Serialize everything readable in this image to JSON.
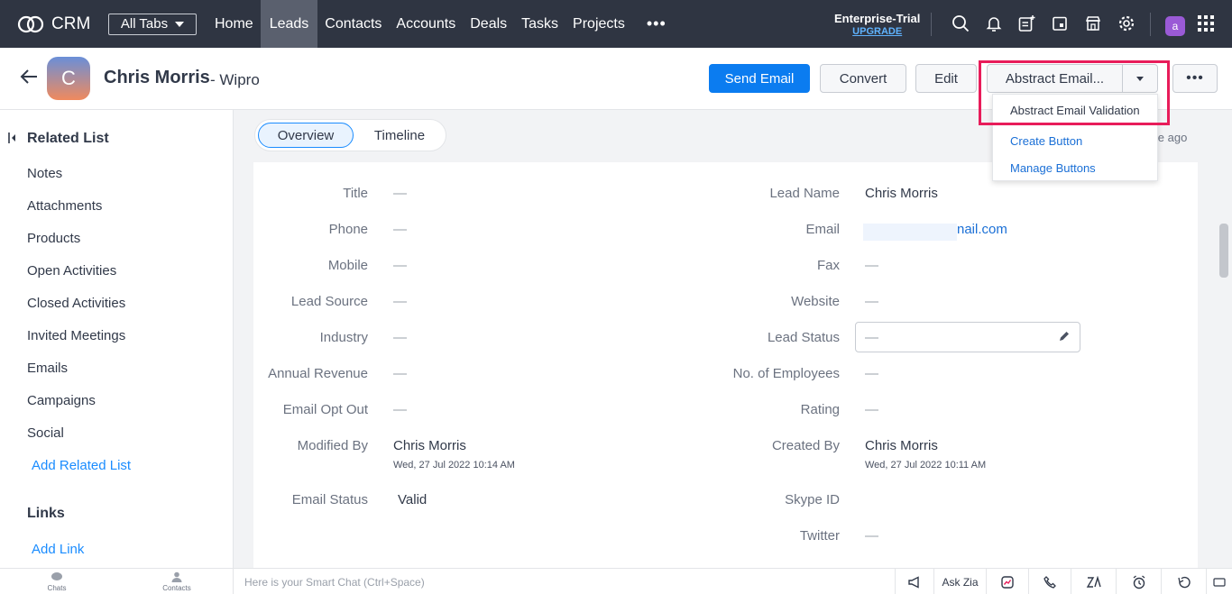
{
  "topnav": {
    "app_name": "CRM",
    "all_tabs_label": "All Tabs",
    "tabs": [
      "Home",
      "Leads",
      "Contacts",
      "Accounts",
      "Deals",
      "Tasks",
      "Projects"
    ],
    "more_label": "•••",
    "trial_label": "Enterprise-Trial",
    "upgrade_label": "UPGRADE",
    "user_initial": "a"
  },
  "record": {
    "avatar_initial": "C",
    "name": "Chris Morris",
    "company": "- Wipro",
    "buttons": {
      "send_email": "Send Email",
      "convert": "Convert",
      "edit": "Edit",
      "abstract_email": "Abstract Email...",
      "more": "•••"
    }
  },
  "dropdown": {
    "items": [
      "Abstract Email Validation",
      "Create Button",
      "Manage Buttons"
    ]
  },
  "sidebar": {
    "related_title": "Related List",
    "items": [
      "Notes",
      "Attachments",
      "Products",
      "Open Activities",
      "Closed Activities",
      "Invited Meetings",
      "Emails",
      "Campaigns",
      "Social"
    ],
    "add_related": "Add Related List",
    "links_title": "Links",
    "add_link": "Add Link"
  },
  "view_tabs": {
    "overview": "Overview",
    "timeline": "Timeline",
    "ago_fragment": "ile ago"
  },
  "fields": {
    "dash": "—",
    "left": [
      {
        "label": "Title",
        "value": "—"
      },
      {
        "label": "Phone",
        "value": "—"
      },
      {
        "label": "Mobile",
        "value": "—"
      },
      {
        "label": "Lead Source",
        "value": "—"
      },
      {
        "label": "Industry",
        "value": "—"
      },
      {
        "label": "Annual Revenue",
        "value": "—"
      },
      {
        "label": "Email Opt Out",
        "value": "—"
      },
      {
        "label": "Modified By",
        "value": "Chris Morris",
        "sub": "Wed, 27 Jul 2022 10:14 AM"
      },
      {
        "label": "Email Status",
        "value": "Valid"
      }
    ],
    "right": [
      {
        "label": "Lead Name",
        "value": "Chris Morris"
      },
      {
        "label": "Email",
        "value": "nail.com"
      },
      {
        "label": "Fax",
        "value": "—"
      },
      {
        "label": "Website",
        "value": "—"
      },
      {
        "label": "Lead Status",
        "value": "—"
      },
      {
        "label": "No. of Employees",
        "value": "—"
      },
      {
        "label": "Rating",
        "value": "—"
      },
      {
        "label": "Created By",
        "value": "Chris Morris",
        "sub": "Wed, 27 Jul 2022 10:11 AM"
      },
      {
        "label": "Skype ID",
        "value": ""
      },
      {
        "label": "Twitter",
        "value": "—"
      }
    ]
  },
  "bottombar": {
    "chats": "Chats",
    "contacts": "Contacts",
    "smart_chat_placeholder": "Here is your Smart Chat (Ctrl+Space)",
    "ask_zia": "Ask Zia"
  },
  "colors": {
    "nav_bg": "#2f3542",
    "primary": "#0b7cf0",
    "highlight": "#e81c5a",
    "link": "#1a8cff"
  }
}
